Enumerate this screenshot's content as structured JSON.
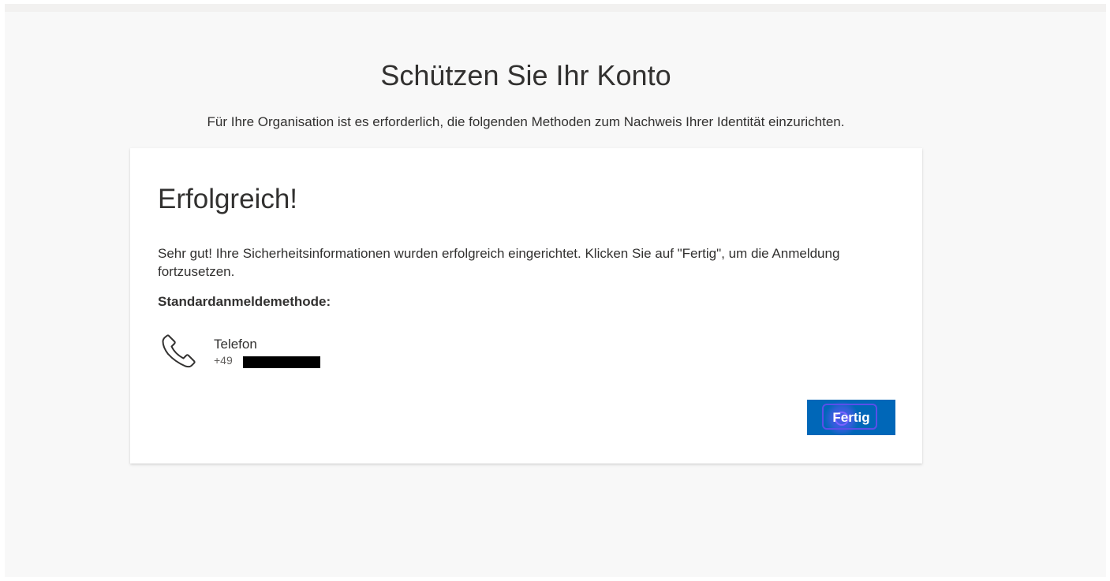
{
  "page": {
    "title": "Schützen Sie Ihr Konto",
    "subtitle": "Für Ihre Organisation ist es erforderlich, die folgenden Methoden zum Nachweis Ihrer Identität einzurichten."
  },
  "card": {
    "heading": "Erfolgreich!",
    "message": "Sehr gut! Ihre Sicherheitsinformationen wurden erfolgreich eingerichtet. Klicken Sie auf \"Fertig\", um die Anmeldung fortzusetzen.",
    "default_method_label": "Standardanmeldemethode:",
    "method": {
      "icon": "phone-icon",
      "name": "Telefon",
      "number": "+49"
    },
    "done_button": "Fertig"
  },
  "colors": {
    "background": "#f8f8f8",
    "card": "#ffffff",
    "primary": "#0067b8",
    "text": "#323130"
  }
}
